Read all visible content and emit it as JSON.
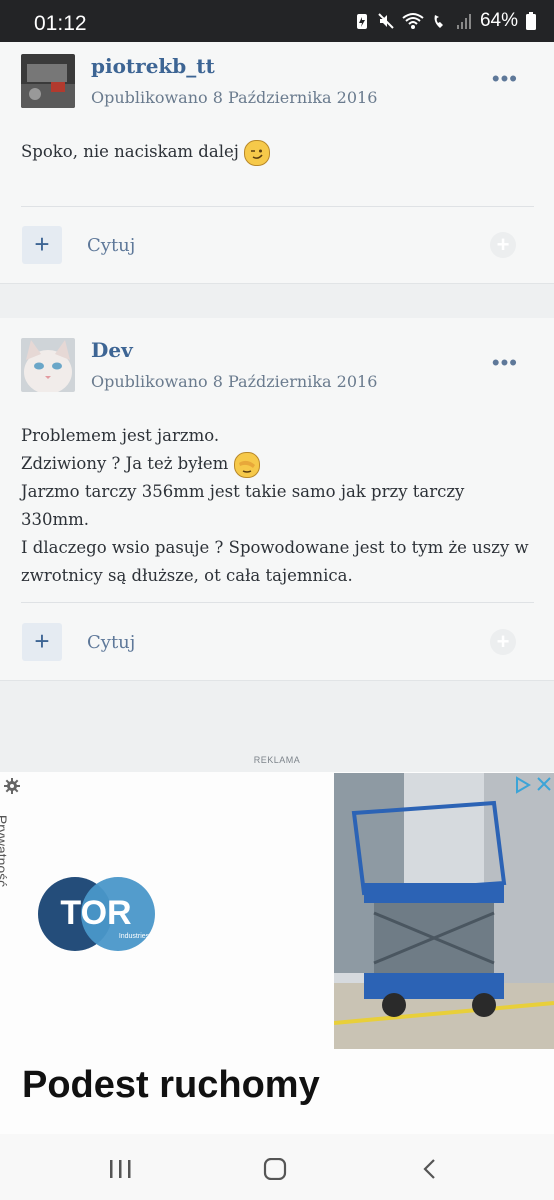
{
  "status_bar": {
    "time": "01:12",
    "battery": "64%"
  },
  "posts": [
    {
      "author": "piotrekb_tt",
      "date": "Opublikowano 8 Października 2016",
      "lines": [
        "Spoko, nie naciskam dalej"
      ],
      "quote_label": "Cytuj"
    },
    {
      "author": "Dev",
      "date": "Opublikowano 8 Października 2016",
      "lines": [
        "Problemem jest jarzmo.",
        "Zdziwiony ? Ja też byłem",
        "Jarzmo tarczy 356mm jest takie samo jak przy tarczy 330mm.",
        "I dlaczego wsio pasuje ? Spowodowane jest to tym że uszy w",
        "zwrotnicy są dłuższe, ot cała tajemnica."
      ],
      "quote_label": "Cytuj"
    }
  ],
  "ad": {
    "label": "REKLAMA",
    "privacy": "Prywatność",
    "brand": "TOR",
    "brand_sub": "Industries",
    "headline": "Podest ruchomy"
  }
}
